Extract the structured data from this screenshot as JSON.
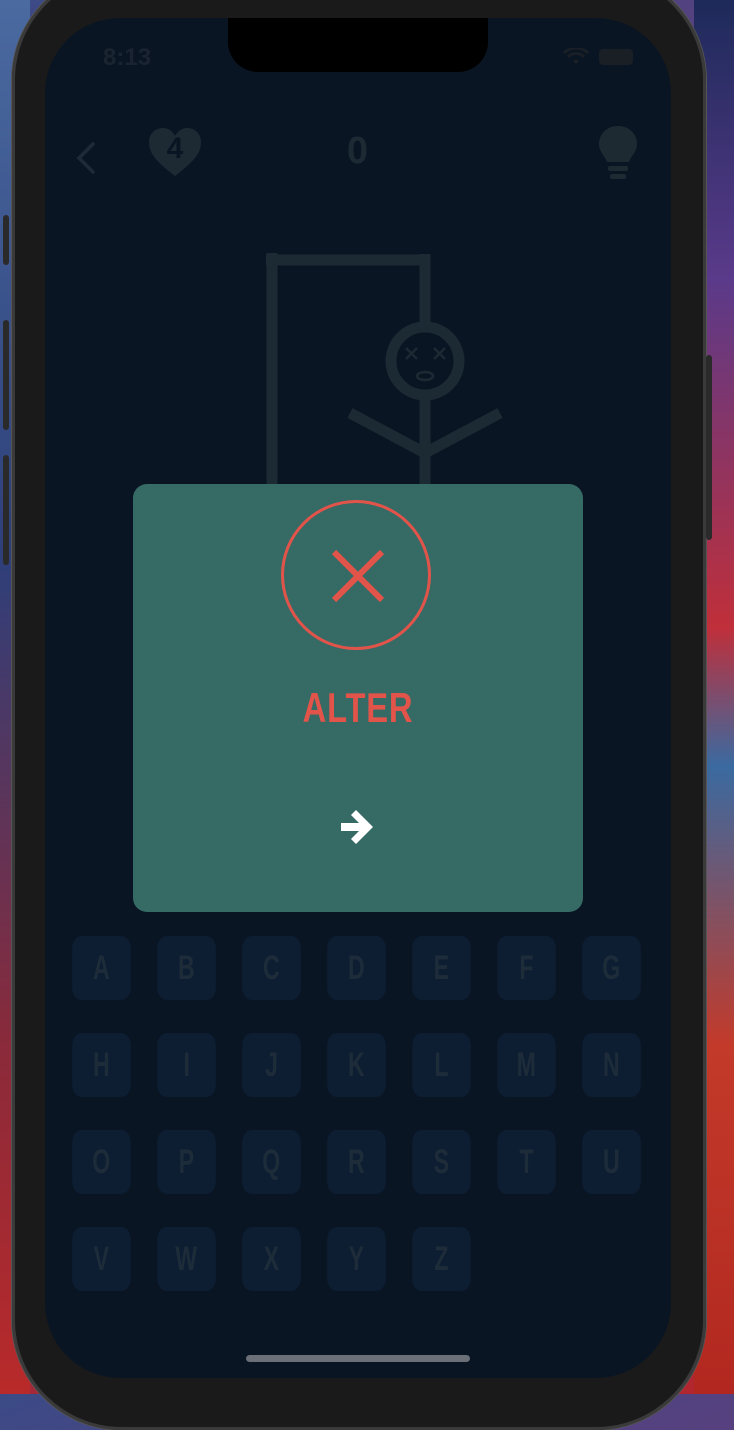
{
  "status_bar": {
    "time": "8:13"
  },
  "header": {
    "lives": "4",
    "score": "0"
  },
  "modal": {
    "word": "ALTER",
    "icon": "close-icon",
    "next_icon": "arrow-right-icon",
    "accent_color": "#e2544a",
    "background_color": "#366a65"
  },
  "keyboard": {
    "rows": [
      [
        "A",
        "B",
        "C",
        "D",
        "E",
        "F",
        "G"
      ],
      [
        "H",
        "I",
        "J",
        "K",
        "L",
        "M",
        "N"
      ],
      [
        "O",
        "P",
        "Q",
        "R",
        "S",
        "T",
        "U"
      ],
      [
        "V",
        "W",
        "X",
        "Y",
        "Z"
      ]
    ]
  }
}
